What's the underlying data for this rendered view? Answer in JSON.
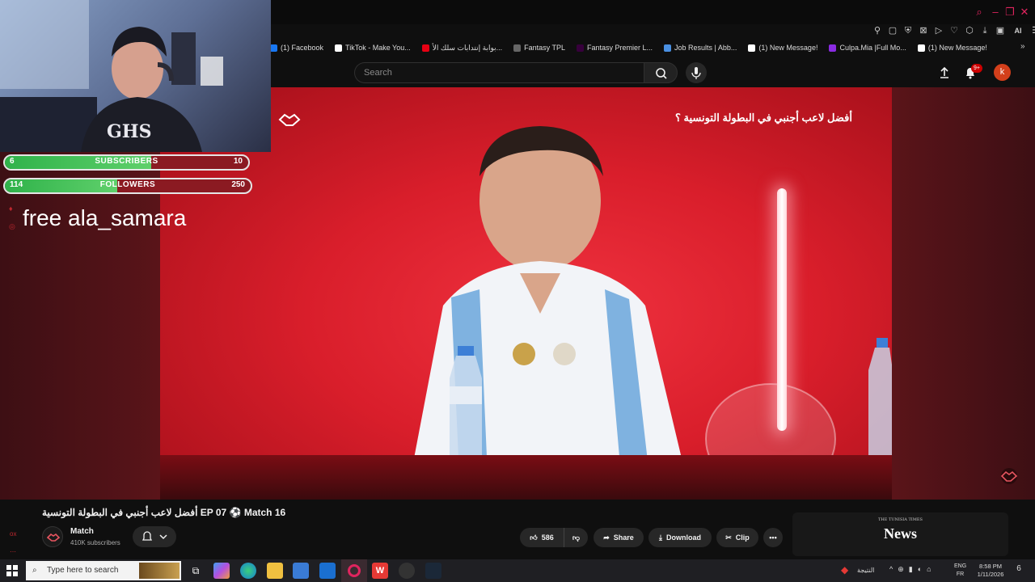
{
  "bookmarks": [
    {
      "label": "(1) Facebook",
      "color": "#1877f2"
    },
    {
      "label": "TikTok - Make You...",
      "color": "#ffffff"
    },
    {
      "label": "بوابة إنتدابات سلك الأ...",
      "color": "#e70013"
    },
    {
      "label": "Fantasy TPL",
      "color": "#666666"
    },
    {
      "label": "Fantasy Premier L...",
      "color": "#37003c"
    },
    {
      "label": "Job Results | Abb...",
      "color": "#4a90e2"
    },
    {
      "label": "(1) New Message!",
      "color": "#ffffff"
    },
    {
      "label": "Culpa.Mia |Full Mo...",
      "color": "#8a2be2"
    },
    {
      "label": "(1) New Message!",
      "color": "#ffffff"
    }
  ],
  "header": {
    "search_placeholder": "Search",
    "notification_count": "9+",
    "avatar_letter": "k"
  },
  "video": {
    "subtitle": "أفضل لاعب أجنبي في البطولة التونسية ؟"
  },
  "overlay": {
    "subscribers": {
      "current": "6",
      "label": "SUBSCRIBERS",
      "goal": "10",
      "progress": 0.6
    },
    "followers": {
      "current": "114",
      "label": "FOLLOWERS",
      "goal": "250",
      "progress": 0.456
    },
    "text": "free ala_samara"
  },
  "info": {
    "title": "أفضل لاعب أجنبي في البطولة التونسية EP 07 ⚽ Match 16",
    "channel_name": "Match",
    "channel_subs": "410K subscribers",
    "like_count": "586",
    "share_label": "Share",
    "download_label": "Download",
    "clip_label": "Clip"
  },
  "news_card": {
    "publisher": "THE TUNISIA TIMES",
    "title": "News"
  },
  "taskbar": {
    "search_placeholder": "Type here to search",
    "weather": "النتيجة",
    "lang_top": "ENG",
    "lang_bottom": "FR",
    "time": "8:58 PM",
    "date": "1/11/2026",
    "notif_count": "6"
  },
  "colors": {
    "accent": "#e0245e",
    "progress_green": "#2fb24a",
    "bar_red": "#8b1a22"
  }
}
